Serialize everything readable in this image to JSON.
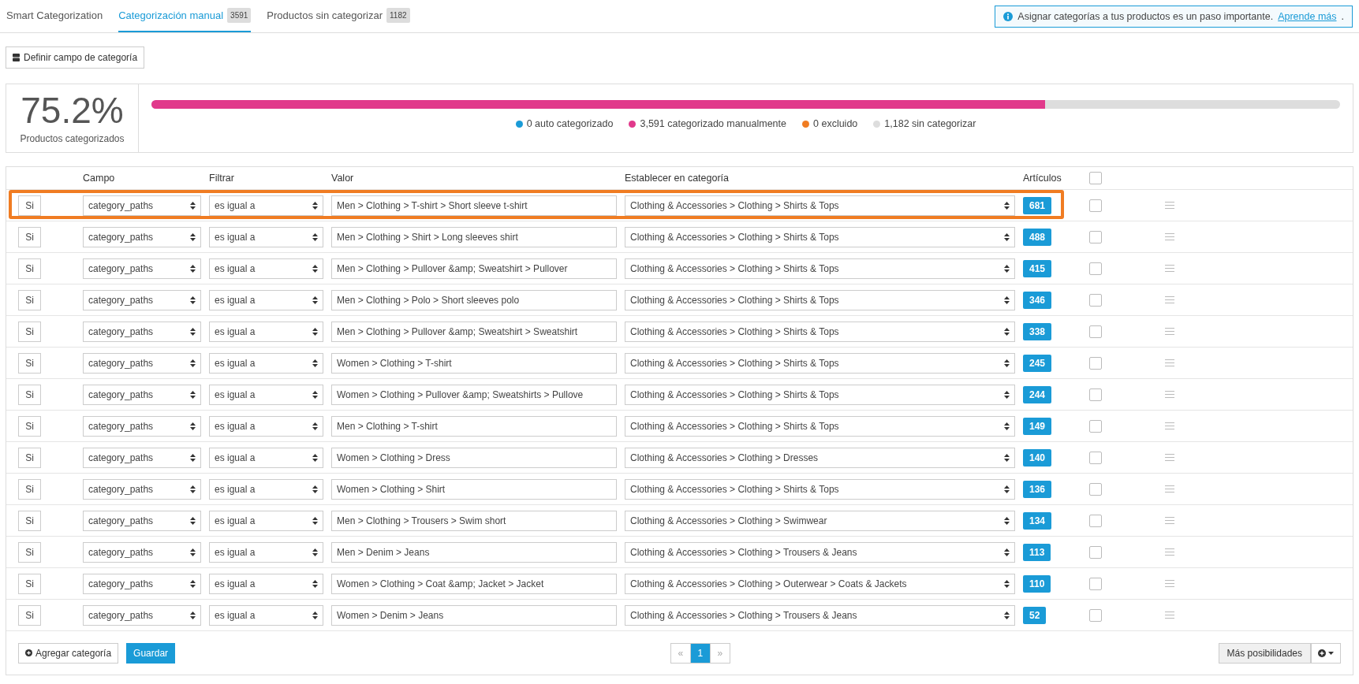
{
  "tabs": [
    {
      "label": "Smart Categorization",
      "selected": false
    },
    {
      "label": "Categorización manual",
      "count": "3591",
      "selected": true
    },
    {
      "label": "Productos sin categorizar",
      "count": "1182",
      "selected": false
    }
  ],
  "notice": {
    "text": "Asignar categorías a tus productos es un paso importante.",
    "link": "Aprende más",
    "after": "."
  },
  "define_button": "Definir campo de categoría",
  "stats": {
    "percent": "75.2%",
    "label": "Productos categorizados",
    "fill": {
      "color": "#e1398b",
      "level": 0.752
    },
    "legend": [
      {
        "label": "0 auto categorizado",
        "color": "#1a9bd7"
      },
      {
        "label": "3,591 categorizado manualmente",
        "color": "#e1398b"
      },
      {
        "label": "0 excluido",
        "color": "#f07c22"
      },
      {
        "label": "1,182 sin categorizar",
        "color": "#dddddd"
      }
    ]
  },
  "table": {
    "columns": [
      "Campo",
      "Filtrar",
      "Valor",
      "Establecer en categoría",
      "Artículos"
    ],
    "header_checked": false,
    "rows": [
      {
        "prefix": "Si",
        "field": "category_paths",
        "filter": "es igual a",
        "value": "Men > Clothing > T-shirt > Short sleeve t-shirt",
        "category": "Clothing & Accessories > Clothing > Shirts & Tops",
        "count": "681",
        "checked": false,
        "highlighted": true
      },
      {
        "prefix": "Si",
        "field": "category_paths",
        "filter": "es igual a",
        "value": "Men > Clothing > Shirt > Long sleeves shirt",
        "category": "Clothing & Accessories > Clothing > Shirts & Tops",
        "count": "488",
        "checked": false,
        "highlighted": false
      },
      {
        "prefix": "Si",
        "field": "category_paths",
        "filter": "es igual a",
        "value": "Men > Clothing > Pullover &amp; Sweatshirt > Pullover",
        "category": "Clothing & Accessories > Clothing > Shirts & Tops",
        "count": "415",
        "checked": false,
        "highlighted": false
      },
      {
        "prefix": "Si",
        "field": "category_paths",
        "filter": "es igual a",
        "value": "Men > Clothing > Polo > Short sleeves polo",
        "category": "Clothing & Accessories > Clothing > Shirts & Tops",
        "count": "346",
        "checked": false,
        "highlighted": false
      },
      {
        "prefix": "Si",
        "field": "category_paths",
        "filter": "es igual a",
        "value": "Men > Clothing > Pullover &amp; Sweatshirt > Sweatshirt",
        "category": "Clothing & Accessories > Clothing > Shirts & Tops",
        "count": "338",
        "checked": false,
        "highlighted": false
      },
      {
        "prefix": "Si",
        "field": "category_paths",
        "filter": "es igual a",
        "value": "Women > Clothing > T-shirt",
        "category": "Clothing & Accessories > Clothing > Shirts & Tops",
        "count": "245",
        "checked": false,
        "highlighted": false
      },
      {
        "prefix": "Si",
        "field": "category_paths",
        "filter": "es igual a",
        "value": "Women > Clothing > Pullover &amp; Sweatshirts > Pullove",
        "category": "Clothing & Accessories > Clothing > Shirts & Tops",
        "count": "244",
        "checked": false,
        "highlighted": false
      },
      {
        "prefix": "Si",
        "field": "category_paths",
        "filter": "es igual a",
        "value": "Men > Clothing > T-shirt",
        "category": "Clothing & Accessories > Clothing > Shirts & Tops",
        "count": "149",
        "checked": false,
        "highlighted": false
      },
      {
        "prefix": "Si",
        "field": "category_paths",
        "filter": "es igual a",
        "value": "Women > Clothing > Dress",
        "category": "Clothing & Accessories > Clothing > Dresses",
        "count": "140",
        "checked": false,
        "highlighted": false
      },
      {
        "prefix": "Si",
        "field": "category_paths",
        "filter": "es igual a",
        "value": "Women > Clothing > Shirt",
        "category": "Clothing & Accessories > Clothing > Shirts & Tops",
        "count": "136",
        "checked": false,
        "highlighted": false
      },
      {
        "prefix": "Si",
        "field": "category_paths",
        "filter": "es igual a",
        "value": "Men > Clothing > Trousers > Swim short",
        "category": "Clothing & Accessories > Clothing > Swimwear",
        "count": "134",
        "checked": false,
        "highlighted": false
      },
      {
        "prefix": "Si",
        "field": "category_paths",
        "filter": "es igual a",
        "value": "Men > Denim > Jeans",
        "category": "Clothing & Accessories > Clothing > Trousers & Jeans",
        "count": "113",
        "checked": false,
        "highlighted": false
      },
      {
        "prefix": "Si",
        "field": "category_paths",
        "filter": "es igual a",
        "value": "Women > Clothing > Coat &amp; Jacket > Jacket",
        "category": "Clothing & Accessories > Clothing > Outerwear > Coats & Jackets",
        "count": "110",
        "checked": false,
        "highlighted": false
      },
      {
        "prefix": "Si",
        "field": "category_paths",
        "filter": "es igual a",
        "value": "Women > Denim > Jeans",
        "category": "Clothing & Accessories > Clothing > Trousers & Jeans",
        "count": "52",
        "checked": false,
        "highlighted": false
      }
    ]
  },
  "footer": {
    "add_button": "Agregar categoría",
    "save_button": "Guardar",
    "pagination": [
      {
        "label": "«",
        "selected": false
      },
      {
        "label": "1",
        "selected": true
      },
      {
        "label": "»",
        "selected": false
      }
    ],
    "more_button": "Más posibilidades"
  }
}
